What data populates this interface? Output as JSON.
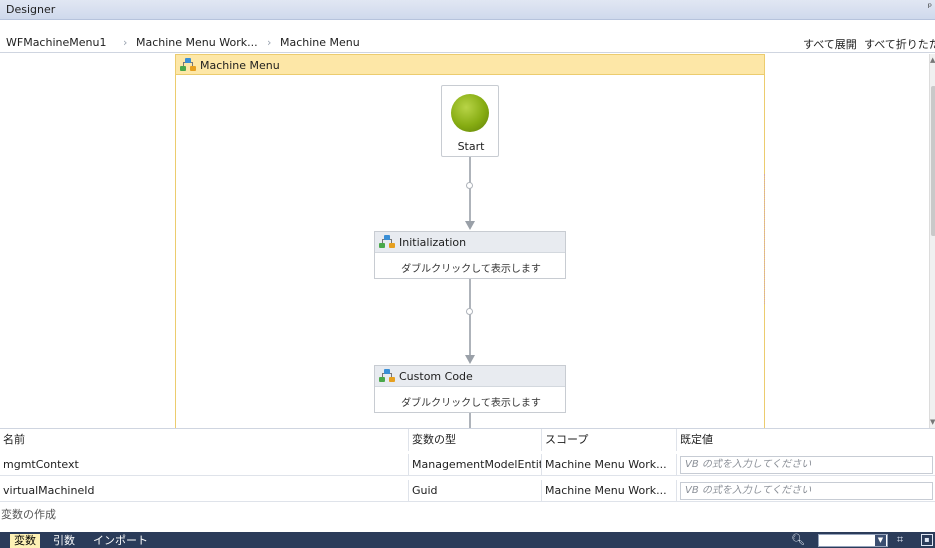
{
  "titlebar": {
    "title": "Designer",
    "pin_glyph": "ᵖ"
  },
  "breadcrumb": {
    "items": [
      "WFMachineMenu1",
      "Machine Menu Work...",
      "Machine Menu"
    ],
    "separator": "›",
    "expand_all": "すべて展開",
    "collapse_all": "すべて折りたたみ"
  },
  "canvas": {
    "flowchart_title": "Machine Menu",
    "start_label": "Start",
    "activities": [
      {
        "title": "Initialization",
        "hint": "ダブルクリックして表示します"
      },
      {
        "title": "Custom Code",
        "hint": "ダブルクリックして表示します"
      }
    ]
  },
  "variables": {
    "headers": [
      "名前",
      "変数の型",
      "スコープ",
      "既定値"
    ],
    "rows": [
      {
        "name": "mgmtContext",
        "type": "ManagementModelEntit",
        "scope": "Machine Menu Work...",
        "default_placeholder": "VB の式を入力してください"
      },
      {
        "name": "virtualMachineId",
        "type": "Guid",
        "scope": "Machine Menu Work...",
        "default_placeholder": "VB の式を入力してください"
      }
    ],
    "create_label": "変数の作成"
  },
  "bottom_tabs": [
    "変数",
    "引数",
    "インポート"
  ],
  "bottom_tools": {
    "search_icon": "search-icon",
    "zoom_value": "",
    "dropdown_glyph": "▼",
    "fit_glyph": "⌗",
    "overview_glyph": "▪"
  },
  "colors": {
    "flowchart_header": "#fde7a7",
    "flowchart_border": "#eccc6e",
    "start_green": "#86ac12",
    "bottombar": "#2b3c5a",
    "active_tab": "#fdf1b5"
  }
}
